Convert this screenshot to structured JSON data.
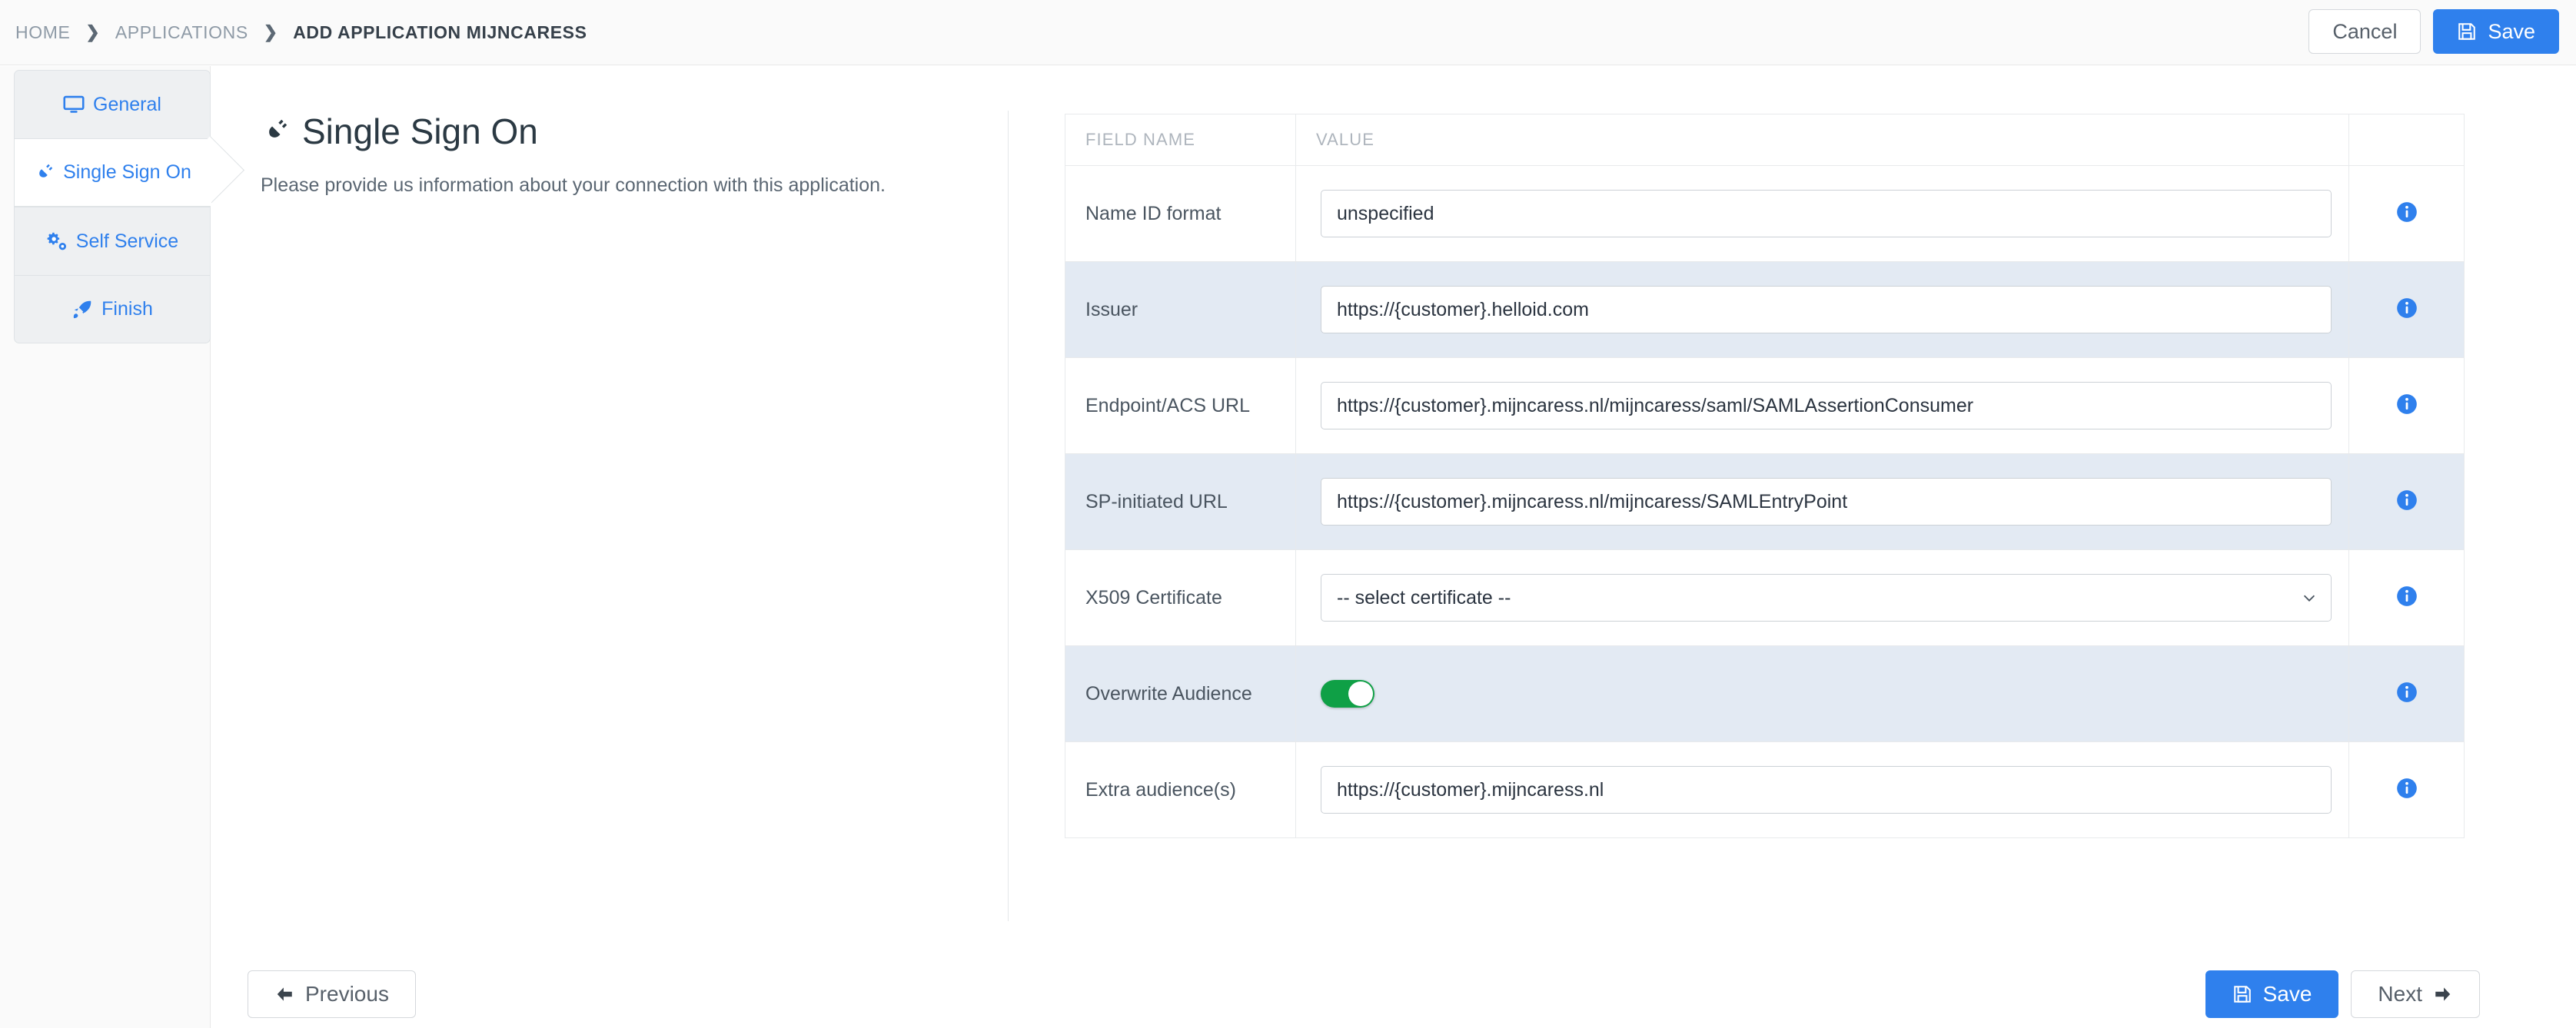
{
  "breadcrumb": {
    "items": [
      {
        "label": "HOME",
        "active": false
      },
      {
        "label": "APPLICATIONS",
        "active": false
      },
      {
        "label": "ADD APPLICATION MIJNCARESS",
        "active": true
      }
    ],
    "separator": "❯"
  },
  "topbar": {
    "cancel_label": "Cancel",
    "save_label": "Save",
    "save_icon": "floppy-disk-icon",
    "primary_color": "#2f80ed"
  },
  "sidebar": {
    "items": [
      {
        "label": "General",
        "icon": "monitor-icon",
        "active": false
      },
      {
        "label": "Single Sign On",
        "icon": "plug-icon",
        "active": true
      },
      {
        "label": "Self Service",
        "icon": "gears-icon",
        "active": false
      },
      {
        "label": "Finish",
        "icon": "rocket-icon",
        "active": false
      }
    ],
    "accent_color": "#2f80ed"
  },
  "page": {
    "title": "Single Sign On",
    "title_icon": "plug-icon",
    "subtitle": "Please provide us information about your connection with this application."
  },
  "table": {
    "headers": {
      "name": "FIELD NAME",
      "value": "VALUE"
    },
    "rows": [
      {
        "name": "Name ID format",
        "type": "text",
        "value": "unspecified",
        "alt": false,
        "info_icon": "info-circle-icon"
      },
      {
        "name": "Issuer",
        "type": "text",
        "value": "https://{customer}.helloid.com",
        "alt": true,
        "info_icon": "info-circle-icon"
      },
      {
        "name": "Endpoint/ACS URL",
        "type": "text",
        "value": "https://{customer}.mijncaress.nl/mijncaress/saml/SAMLAssertionConsumer",
        "alt": false,
        "info_icon": "info-circle-icon"
      },
      {
        "name": "SP-initiated URL",
        "type": "text",
        "value": "https://{customer}.mijncaress.nl/mijncaress/SAMLEntryPoint",
        "alt": true,
        "info_icon": "info-circle-icon"
      },
      {
        "name": "X509 Certificate",
        "type": "select",
        "value": "-- select certificate --",
        "alt": false,
        "info_icon": "info-circle-icon"
      },
      {
        "name": "Overwrite Audience",
        "type": "toggle",
        "value": "on",
        "toggle_color": "#0fa046",
        "alt": true,
        "info_icon": "info-circle-icon"
      },
      {
        "name": "Extra audience(s)",
        "type": "text",
        "value": "https://{customer}.mijncaress.nl",
        "alt": false,
        "info_icon": "info-circle-icon"
      }
    ]
  },
  "footer": {
    "previous_label": "Previous",
    "previous_icon": "arrow-left-icon",
    "save_label": "Save",
    "save_icon": "floppy-disk-icon",
    "next_label": "Next",
    "next_icon": "arrow-right-icon"
  }
}
